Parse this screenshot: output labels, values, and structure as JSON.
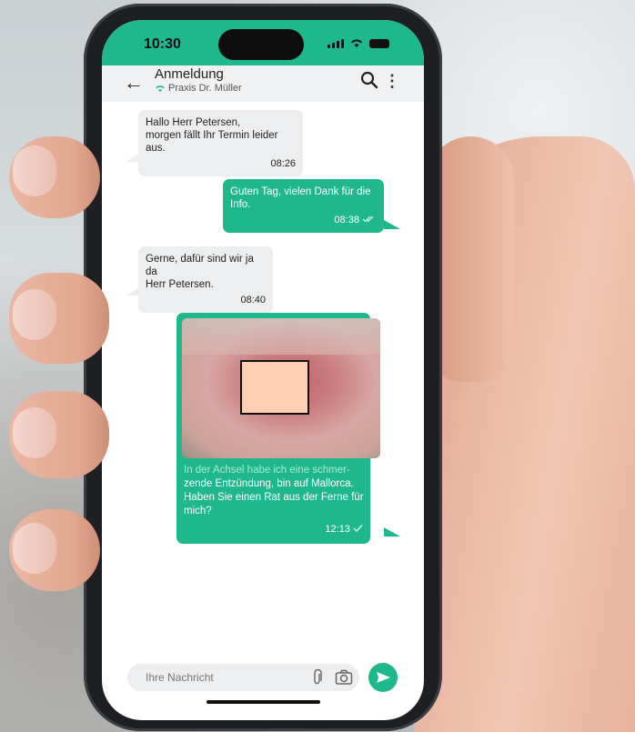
{
  "status": {
    "time": "10:30"
  },
  "header": {
    "title": "Anmeldung",
    "subtitle": "Praxis Dr. Müller"
  },
  "messages": [
    {
      "direction": "in",
      "text_line1": "Hallo Herr Petersen,",
      "text_line2": "morgen fällt Ihr Termin leider aus.",
      "time": "08:26"
    },
    {
      "direction": "out",
      "text_line1": "Guten Tag, vielen Dank für die",
      "text_line2": "Info.",
      "time": "08:38"
    },
    {
      "direction": "in",
      "text_line1": "Gerne, dafür sind wir ja da",
      "text_line2": "Herr Petersen.",
      "time": "08:40"
    },
    {
      "direction": "out",
      "type": "image",
      "caption_line1": "In der Achsel habe ich eine schmer-",
      "caption_line2": "zende Entzündung, bin auf Mallorca.",
      "caption_line3": "Haben Sie einen Rat aus der Ferne für",
      "caption_line4": "mich?",
      "time": "12:13"
    }
  ],
  "composer": {
    "placeholder": "Ihre Nachricht"
  },
  "icons": {
    "back": "arrow-left-icon",
    "search": "search-icon",
    "menu": "more-vertical-icon",
    "wifi": "wifi-icon",
    "attach": "paperclip-icon",
    "camera": "camera-icon",
    "send": "send-icon",
    "read": "double-check-icon",
    "sent": "check-icon"
  },
  "colors": {
    "accent": "#1fb88d",
    "incoming_bubble": "#eceeef",
    "header": "#f0f1f2"
  }
}
